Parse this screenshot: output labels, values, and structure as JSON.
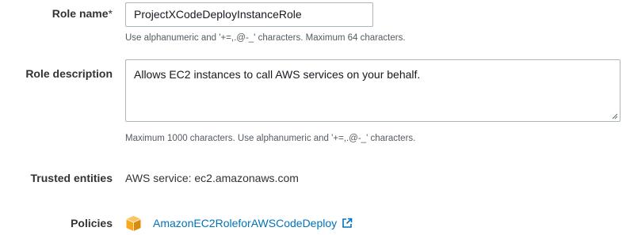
{
  "role_name": {
    "label": "Role name",
    "required_marker": "*",
    "value": "ProjectXCodeDeployInstanceRole",
    "hint": "Use alphanumeric and '+=,.@-_' characters. Maximum 64 characters."
  },
  "role_description": {
    "label": "Role description",
    "value": "Allows EC2 instances to call AWS services on your behalf.",
    "hint": "Maximum 1000 characters. Use alphanumeric and '+=,.@-_' characters."
  },
  "trusted_entities": {
    "label": "Trusted entities",
    "value": "AWS service: ec2.amazonaws.com"
  },
  "policies": {
    "label": "Policies",
    "items": [
      {
        "name": "AmazonEC2RoleforAWSCodeDeploy",
        "icon": "policy-cube-icon",
        "external_icon": "external-link-icon"
      }
    ]
  },
  "colors": {
    "link": "#0073bb",
    "policy_icon": "#f7a81b",
    "hint_text": "#545b64",
    "input_border": "#aab7b8"
  }
}
